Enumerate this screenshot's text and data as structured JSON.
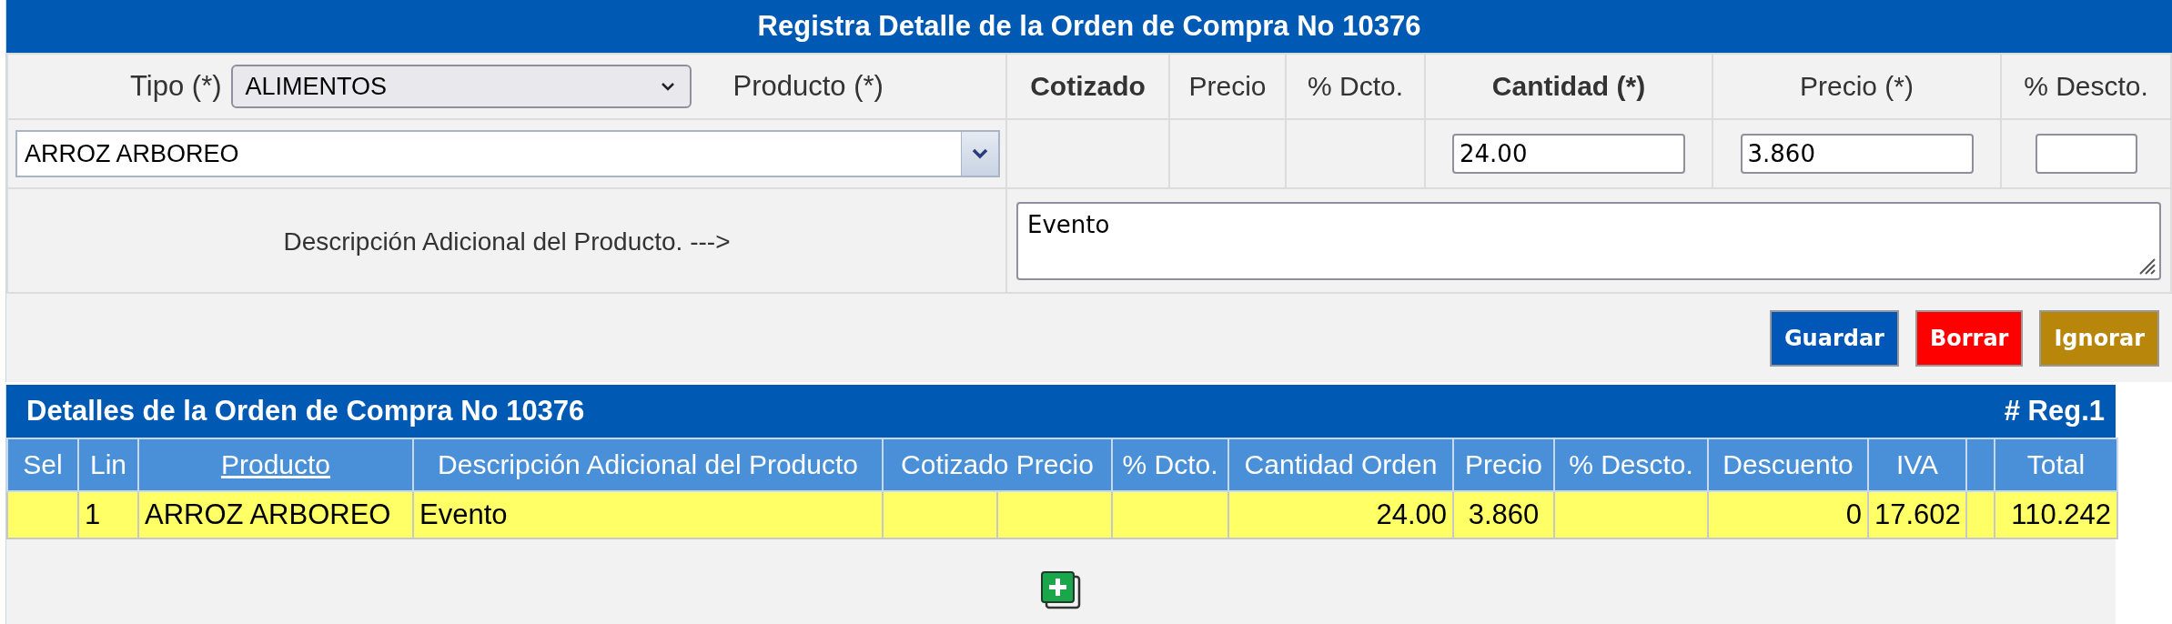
{
  "form": {
    "title": "Registra Detalle de la Orden de Compra No 10376",
    "tipo": {
      "label": "Tipo (*)",
      "value": "ALIMENTOS"
    },
    "producto": {
      "label": "Producto (*)",
      "value": "ARROZ ARBOREO"
    },
    "columns": [
      {
        "label": "Cotizado",
        "bold": true
      },
      {
        "label": "Precio",
        "bold": false
      },
      {
        "label": "% Dcto.",
        "bold": false
      },
      {
        "label": "Cantidad (*)",
        "bold": true
      },
      {
        "label": "Precio (*)",
        "bold": false
      },
      {
        "label": "% Descto.",
        "bold": false
      }
    ],
    "cantidad": "24.00",
    "precio": "3.860",
    "descripcion_label": "Descripción Adicional del Producto. --->",
    "descripcion": "Evento",
    "buttons": [
      {
        "label": "Guardar",
        "kind": "save"
      },
      {
        "label": "Borrar",
        "kind": "delete"
      },
      {
        "label": "Ignorar",
        "kind": "ignore"
      }
    ]
  },
  "details": {
    "title": "Detalles de la Orden de Compra No 10376",
    "count": "# Reg.1",
    "columns": [
      {
        "label": "Sel",
        "kind": "plain"
      },
      {
        "label": "Lin",
        "kind": "plain"
      },
      {
        "label": "Producto",
        "kind": "link"
      },
      {
        "label": "Descripción Adicional del Producto",
        "kind": "plain"
      },
      {
        "label": "Cotizado Precio",
        "kind": "double"
      },
      {
        "label": "% Dcto.",
        "kind": "plain"
      },
      {
        "label": "Cantidad Orden",
        "kind": "plain"
      },
      {
        "label": "Precio",
        "kind": "plain"
      },
      {
        "label": "% Descto.",
        "kind": "plain"
      },
      {
        "label": "Descuento",
        "kind": "plain"
      },
      {
        "label": "IVA",
        "kind": "plain"
      },
      {
        "kind": "blank"
      },
      {
        "label": "Total",
        "kind": "plain"
      }
    ],
    "rows": [
      {
        "selected": true,
        "lin": "1",
        "producto": "ARROZ ARBOREO",
        "descripcion": "Evento",
        "cantidad": "24.00",
        "precio": "3.860",
        "descuento": "0",
        "iva": "17.602",
        "total": "110.242"
      }
    ]
  }
}
